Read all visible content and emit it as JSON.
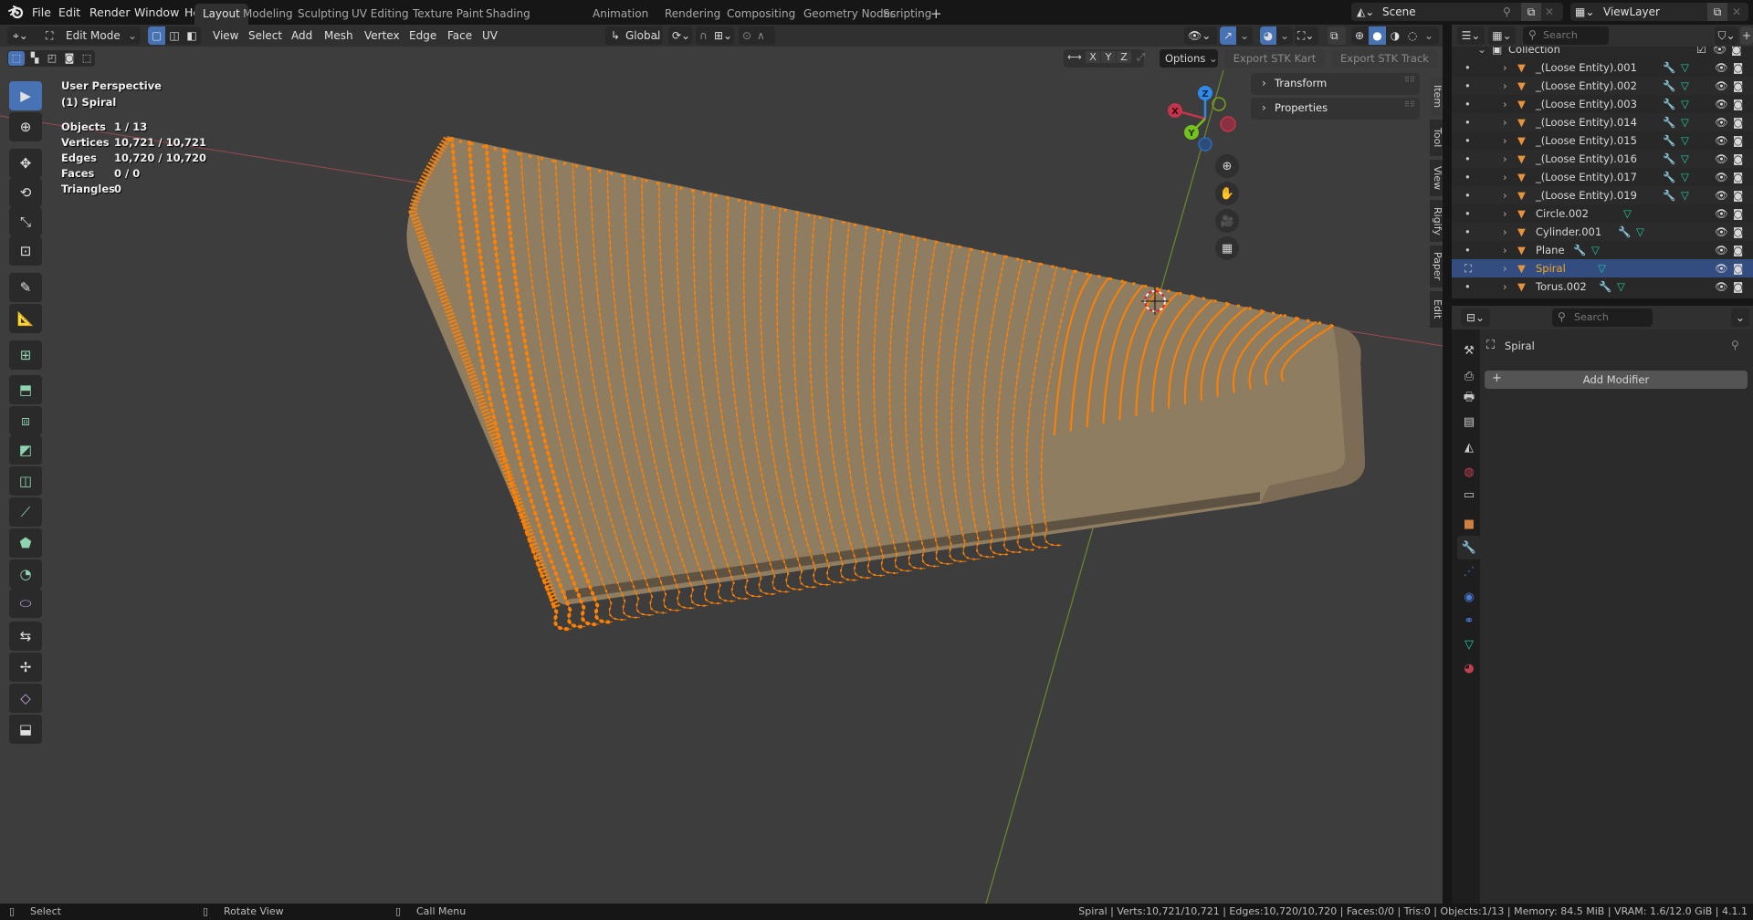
{
  "app": {
    "name": "Blender",
    "version": "4.1.1"
  },
  "menu": [
    "File",
    "Edit",
    "Render",
    "Window",
    "Help"
  ],
  "workspaces": [
    {
      "label": "Layout",
      "active": true
    },
    {
      "label": "Modeling"
    },
    {
      "label": "Sculpting"
    },
    {
      "label": "UV Editing"
    },
    {
      "label": "Texture Paint"
    },
    {
      "label": "Shading"
    },
    {
      "label": "Animation"
    },
    {
      "label": "Rendering"
    },
    {
      "label": "Compositing"
    },
    {
      "label": "Geometry Nodes"
    },
    {
      "label": "Scripting"
    }
  ],
  "add_workspace": "+",
  "scene": {
    "label": "Scene",
    "view_layer": "ViewLayer"
  },
  "viewport_header": {
    "mode": "Edit Mode",
    "menus": [
      "View",
      "Select",
      "Add",
      "Mesh",
      "Vertex",
      "Edge",
      "Face",
      "UV"
    ],
    "transform_orientation": "Global",
    "mirror_axes": [
      "X",
      "Y",
      "Z"
    ],
    "options_label": "Options",
    "export_kart": "Export STK Kart",
    "export_track": "Export STK Track",
    "shading_active": "solid"
  },
  "overlay": {
    "view_name": "User Perspective",
    "object_name": "(1) Spiral",
    "stats": [
      {
        "label": "Objects",
        "value": "1 / 13"
      },
      {
        "label": "Vertices",
        "value": "10,721 / 10,721"
      },
      {
        "label": "Edges",
        "value": "10,720 / 10,720"
      },
      {
        "label": "Faces",
        "value": "0 / 0"
      },
      {
        "label": "Triangles",
        "value": "0"
      }
    ]
  },
  "gizmo": {
    "x": "X",
    "y": "Y",
    "z": "Z"
  },
  "sidebar_panels": [
    "Transform",
    "Properties"
  ],
  "sidebar_tabs": [
    "Item",
    "Tool",
    "View",
    "Rigify",
    "Paper",
    "Edit"
  ],
  "tools": [
    "select-box",
    "cursor",
    "move",
    "rotate",
    "scale",
    "transform",
    "annotate",
    "measure",
    "add-cube",
    "extrude-region",
    "inset-faces",
    "bevel",
    "loop-cut",
    "knife",
    "poly-build",
    "spin",
    "smooth",
    "edge-slide",
    "shrink-fatten",
    "shear",
    "rip-region"
  ],
  "outliner": {
    "search_placeholder": "Search",
    "collection": "Collection",
    "items": [
      {
        "name": "_(Loose Entity).001",
        "modifier": true,
        "mesh": true
      },
      {
        "name": "_(Loose Entity).002",
        "modifier": true,
        "mesh": true
      },
      {
        "name": "_(Loose Entity).003",
        "modifier": true,
        "mesh": true
      },
      {
        "name": "_(Loose Entity).014",
        "modifier": true,
        "mesh": true
      },
      {
        "name": "_(Loose Entity).015",
        "modifier": true,
        "mesh": true
      },
      {
        "name": "_(Loose Entity).016",
        "modifier": true,
        "mesh": true
      },
      {
        "name": "_(Loose Entity).017",
        "modifier": true,
        "mesh": true
      },
      {
        "name": "_(Loose Entity).019",
        "modifier": true,
        "mesh": true
      },
      {
        "name": "Circle.002",
        "modifier": false,
        "mesh": true
      },
      {
        "name": "Cylinder.001",
        "modifier": true,
        "mesh": true
      },
      {
        "name": "Plane",
        "modifier": true,
        "mesh": true
      },
      {
        "name": "Spiral",
        "modifier": false,
        "mesh": true,
        "selected": true
      },
      {
        "name": "Torus.002",
        "modifier": true,
        "mesh": true
      }
    ]
  },
  "properties": {
    "search_placeholder": "Search",
    "object_name": "Spiral",
    "add_modifier": "Add Modifier",
    "tabs": [
      "tool",
      "render",
      "output",
      "view-layer",
      "scene",
      "world",
      "collection",
      "object",
      "modifiers",
      "particles",
      "physics",
      "constraints",
      "data",
      "material"
    ],
    "active_tab": "modifiers"
  },
  "statusbar": {
    "left": [
      {
        "label": "Select"
      },
      {
        "label": "Rotate View"
      },
      {
        "label": "Call Menu"
      }
    ],
    "right": "Spiral | Verts:10,721/10,721 | Edges:10,720/10,720 | Faces:0/0 | Tris:0 | Objects:1/13 | Memory: 84.5 MiB | VRAM: 1.6/12.0 GiB | 4.1.1"
  },
  "colors": {
    "accent": "#4772b3",
    "selected_row": "#334d80",
    "vertex_select": "#ff8000",
    "mesh_surface": "#8f7d62",
    "axis_x": "#c3354a",
    "axis_y": "#75c11f",
    "axis_z": "#2d8ceb"
  }
}
